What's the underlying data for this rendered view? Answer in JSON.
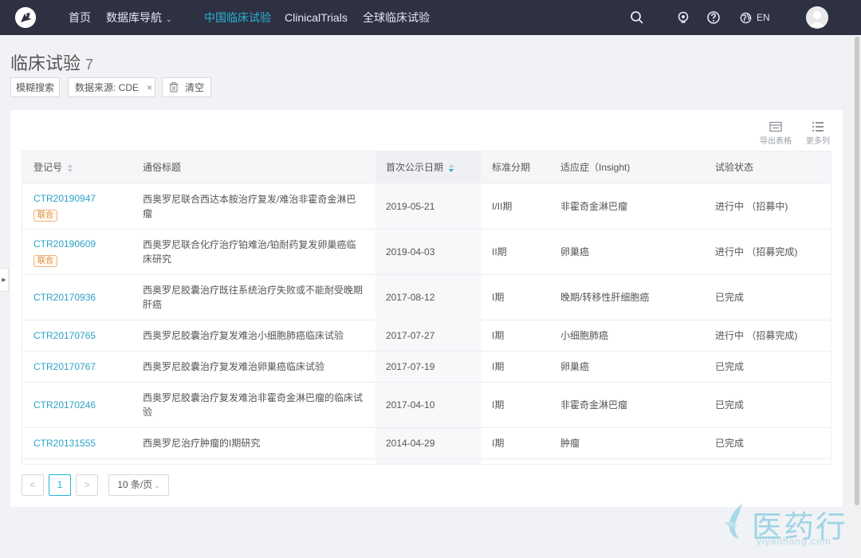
{
  "nav": {
    "items": [
      {
        "label": "首页"
      },
      {
        "label": "数据库导航"
      },
      {
        "label": "中国临床试验"
      },
      {
        "label": "ClinicalTrials"
      },
      {
        "label": "全球临床试验"
      }
    ],
    "lang": "EN",
    "active_color": "#27b3d6"
  },
  "page": {
    "title": "临床试验",
    "count": "7"
  },
  "filters": {
    "fuzzy": "模糊搜索",
    "source": "数据来源: CDE",
    "source_remove": "×",
    "clear": "清空"
  },
  "tools": {
    "export": "导出表格",
    "more": "更多列"
  },
  "table": {
    "headers": [
      "登记号",
      "通俗标题",
      "首次公示日期",
      "标准分期",
      "适应症（Insight)",
      "试验状态"
    ],
    "rows": [
      {
        "id": "CTR20190947",
        "tag": "联合",
        "title_l1": "西奥罗尼联合西达本胺治疗复发/难治非霍奇金淋巴",
        "title_l2": "瘤",
        "date": "2019-05-21",
        "phase": "I/II期",
        "indication": "非霍奇金淋巴瘤",
        "status": "进行中 （招募中)"
      },
      {
        "id": "CTR20190609",
        "tag": "联合",
        "title_l1": "西奥罗尼联合化疗治疗铂难治/铂耐药复发卵巢癌临",
        "title_l2": "床研究",
        "date": "2019-04-03",
        "phase": "II期",
        "indication": "卵巢癌",
        "status": "进行中 （招募完成)"
      },
      {
        "id": "CTR20170936",
        "tag": "",
        "title_l1": "西奥罗尼胶囊治疗既往系统治疗失败或不能耐受晚期",
        "title_l2": "肝癌",
        "date": "2017-08-12",
        "phase": "I期",
        "indication": "晚期/转移性肝细胞癌",
        "status": "已完成"
      },
      {
        "id": "CTR20170765",
        "tag": "",
        "title_l1": "西奥罗尼胶囊治疗复发难治小细胞肺癌临床试验",
        "title_l2": "",
        "date": "2017-07-27",
        "phase": "I期",
        "indication": "小细胞肺癌",
        "status": "进行中 （招募完成)"
      },
      {
        "id": "CTR20170767",
        "tag": "",
        "title_l1": "西奥罗尼胶囊治疗复发难治卵巢癌临床试验",
        "title_l2": "",
        "date": "2017-07-19",
        "phase": "I期",
        "indication": "卵巢癌",
        "status": "已完成"
      },
      {
        "id": "CTR20170246",
        "tag": "",
        "title_l1": "西奥罗尼胶囊治疗复发难治非霍奇金淋巴瘤的临床试",
        "title_l2": "验",
        "date": "2017-04-10",
        "phase": "I期",
        "indication": "非霍奇金淋巴瘤",
        "status": "已完成"
      },
      {
        "id": "CTR20131555",
        "tag": "",
        "title_l1": "西奥罗尼治疗肿瘤的I期研究",
        "title_l2": "",
        "date": "2014-04-29",
        "phase": "I期",
        "indication": "肿瘤",
        "status": "已完成"
      }
    ]
  },
  "pagination": {
    "prev": "<",
    "current": "1",
    "next": ">",
    "page_size": "10 条/页"
  },
  "watermark": {
    "cn": "医药行",
    "en": "yiyaohang.com"
  }
}
